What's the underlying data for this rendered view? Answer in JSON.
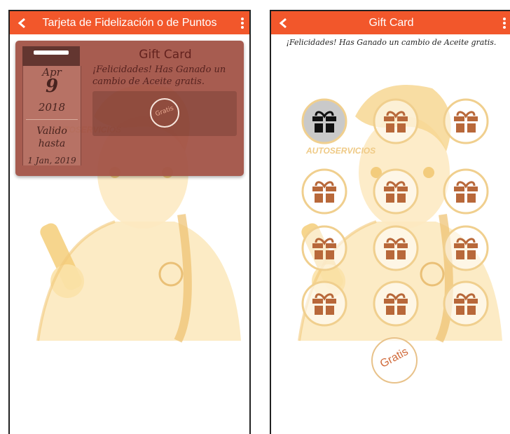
{
  "colors": {
    "accent": "#f2572b",
    "card": "#a25246",
    "gift": "#b8683a",
    "ring": "#f0cf8e"
  },
  "left_screen": {
    "title": "Tarjeta de Fidelización o de Puntos",
    "icons": {
      "back": "chevron-left-icon",
      "menu": "more-vertical-icon"
    },
    "card": {
      "month": "Apr",
      "day": "9",
      "year": "2018",
      "valid_label": "Valido hasta",
      "valid_until": "1 Jan, 2019",
      "title": "Gift Card",
      "message": "¡Felicidades! Has Ganado un cambio de Aceite gratis.",
      "scratch_label": "Gratis"
    }
  },
  "right_screen": {
    "title": "Gift Card",
    "icons": {
      "back": "chevron-left-icon",
      "menu": "more-vertical-icon"
    },
    "message": "¡Felicidades! Has Ganado un cambio de Aceite gratis.",
    "stamps": [
      {
        "state": "used"
      },
      {
        "state": "available"
      },
      {
        "state": "available"
      },
      {
        "state": "available"
      },
      {
        "state": "available"
      },
      {
        "state": "available"
      },
      {
        "state": "available"
      },
      {
        "state": "available"
      },
      {
        "state": "available"
      },
      {
        "state": "available"
      },
      {
        "state": "available"
      },
      {
        "state": "available"
      }
    ],
    "reward_label": "Gratis"
  }
}
